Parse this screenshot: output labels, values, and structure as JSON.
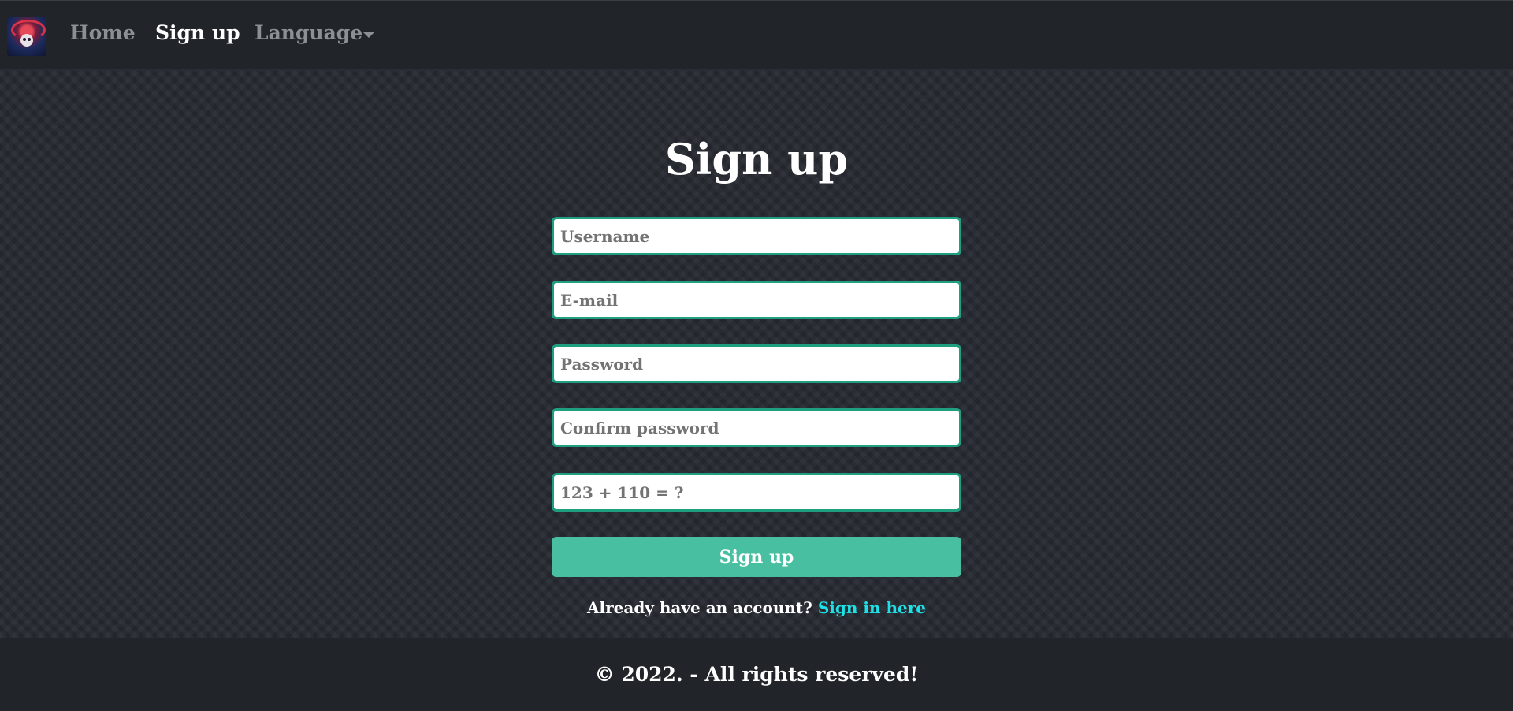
{
  "navbar": {
    "logo_icon": "skull-avatar-icon",
    "links": {
      "home": "Home",
      "signup": "Sign up",
      "language": "Language"
    },
    "language_caret_icon": "caret-down-icon"
  },
  "form": {
    "title": "Sign up",
    "username_placeholder": "Username",
    "email_placeholder": "E-mail",
    "password_placeholder": "Password",
    "confirm_placeholder": "Confirm password",
    "captcha_placeholder": "123 + 110 = ?",
    "submit_label": "Sign up",
    "signin_prompt": "Already have an account?",
    "signin_link": "Sign in here"
  },
  "footer": {
    "text": "© 2022. - All rights reserved!"
  },
  "colors": {
    "accent": "#48bfa0",
    "field_border": "#1f9e80",
    "link": "#1ee0e6",
    "navbar_bg": "#212529"
  }
}
